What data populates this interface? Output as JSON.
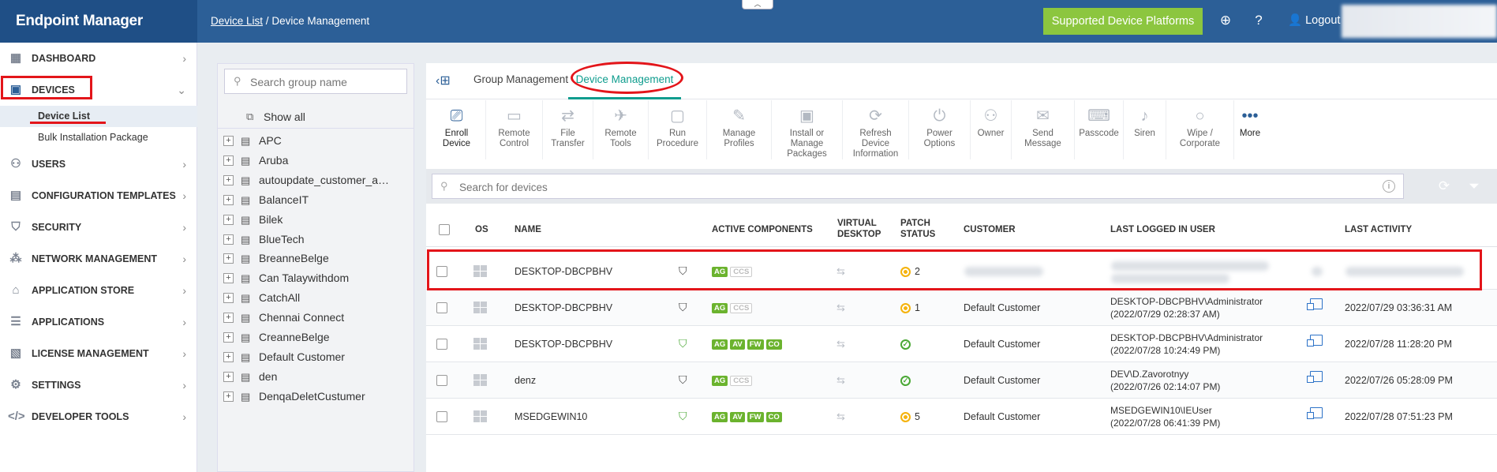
{
  "app": {
    "title": "Endpoint Manager"
  },
  "breadcrumb": {
    "link": "Device List",
    "separator": "/",
    "current": "Device Management"
  },
  "header": {
    "supported_btn": "Supported Device Platforms",
    "logout": "Logout",
    "icons": [
      "add-circle-icon",
      "help-icon",
      "user-icon"
    ]
  },
  "sidebar": {
    "items": [
      {
        "label": "DASHBOARD",
        "icon": "dashboard-icon"
      },
      {
        "label": "DEVICES",
        "icon": "devices-icon"
      },
      {
        "label": "USERS",
        "icon": "user-icon"
      },
      {
        "label": "CONFIGURATION TEMPLATES",
        "icon": "templates-icon"
      },
      {
        "label": "SECURITY",
        "icon": "shield-icon"
      },
      {
        "label": "NETWORK MANAGEMENT",
        "icon": "network-icon"
      },
      {
        "label": "APPLICATION STORE",
        "icon": "store-icon"
      },
      {
        "label": "APPLICATIONS",
        "icon": "applications-icon"
      },
      {
        "label": "LICENSE MANAGEMENT",
        "icon": "license-icon"
      },
      {
        "label": "SETTINGS",
        "icon": "gear-icon"
      },
      {
        "label": "DEVELOPER TOOLS",
        "icon": "code-icon"
      }
    ],
    "sub_items": [
      "Device List",
      "Bulk Installation Package"
    ]
  },
  "groups": {
    "search_placeholder": "Search group name",
    "show_all": "Show all",
    "items": [
      "APC",
      "Aruba",
      "autoupdate_customer_a…",
      "BalanceIT",
      "Bilek",
      "BlueTech",
      "BreanneBelge",
      "Can Talaywithdom",
      "CatchAll",
      "Chennai Connect",
      "CreanneBelge",
      "Default Customer",
      "den",
      "DenqaDeletCustumer"
    ]
  },
  "tabs": [
    "Group Management",
    "Device Management"
  ],
  "toolbar": [
    {
      "label": "Enroll Device",
      "icon": "enroll-device-icon",
      "enabled": true
    },
    {
      "label": "Remote Control",
      "icon": "remote-control-icon",
      "enabled": false
    },
    {
      "label": "File Transfer",
      "icon": "file-transfer-icon",
      "enabled": false
    },
    {
      "label": "Remote Tools",
      "icon": "remote-tools-icon",
      "enabled": false
    },
    {
      "label": "Run Procedure",
      "icon": "run-procedure-icon",
      "enabled": false
    },
    {
      "label": "Manage Profiles",
      "icon": "manage-profiles-icon",
      "enabled": false
    },
    {
      "label": "Install or Manage Packages",
      "icon": "packages-icon",
      "enabled": false
    },
    {
      "label": "Refresh Device Information",
      "icon": "refresh-icon",
      "enabled": false
    },
    {
      "label": "Power Options",
      "icon": "power-icon",
      "enabled": false
    },
    {
      "label": "Owner",
      "icon": "owner-icon",
      "enabled": false
    },
    {
      "label": "Send Message",
      "icon": "envelope-icon",
      "enabled": false
    },
    {
      "label": "Passcode",
      "icon": "passcode-icon",
      "enabled": false
    },
    {
      "label": "Siren",
      "icon": "siren-icon",
      "enabled": false
    },
    {
      "label": "Wipe / Corporate",
      "icon": "wipe-icon",
      "enabled": false
    },
    {
      "label": "More",
      "icon": "more-icon",
      "enabled": true
    }
  ],
  "device_search": {
    "placeholder": "Search for devices"
  },
  "table": {
    "headers": {
      "os": "OS",
      "name": "NAME",
      "active_components": "ACTIVE COMPONENTS",
      "virtual_desktop_1": "VIRTUAL",
      "virtual_desktop_2": "DESKTOP",
      "patch_status_1": "PATCH",
      "patch_status_2": "STATUS",
      "customer": "CUSTOMER",
      "last_logged_user": "LAST LOGGED IN USER",
      "last_activity": "LAST ACTIVITY"
    },
    "rows": [
      {
        "name": "DESKTOP-DBCPBHV",
        "components": [
          "AG"
        ],
        "off": [
          "CCS"
        ],
        "patch": "warn",
        "patch_count": "2",
        "customer": "",
        "user": "",
        "user_time": "",
        "activity": "",
        "redacted": true
      },
      {
        "name": "DESKTOP-DBCPBHV",
        "components": [
          "AG"
        ],
        "off": [
          "CCS"
        ],
        "patch": "warn",
        "patch_count": "1",
        "customer": "Default Customer",
        "user": "DESKTOP-DBCPBHV\\Administrator",
        "user_time": "(2022/07/29 02:28:37 AM)",
        "activity": "2022/07/29 03:36:31 AM"
      },
      {
        "name": "DESKTOP-DBCPBHV",
        "components": [
          "AG",
          "AV",
          "FW",
          "CO"
        ],
        "off": [],
        "patch": "ok",
        "patch_count": "",
        "customer": "Default Customer",
        "user": "DESKTOP-DBCPBHV\\Administrator",
        "user_time": "(2022/07/28 10:24:49 PM)",
        "activity": "2022/07/28 11:28:20 PM"
      },
      {
        "name": "denz",
        "components": [
          "AG"
        ],
        "off": [
          "CCS"
        ],
        "patch": "ok",
        "patch_count": "",
        "customer": "Default Customer",
        "user": "DEV\\D.Zavorotnyy",
        "user_time": "(2022/07/26 02:14:07 PM)",
        "activity": "2022/07/26 05:28:09 PM"
      },
      {
        "name": "MSEDGEWIN10",
        "components": [
          "AG",
          "AV",
          "FW",
          "CO"
        ],
        "off": [],
        "patch": "warn",
        "patch_count": "5",
        "customer": "Default Customer",
        "user": "MSEDGEWIN10\\IEUser",
        "user_time": "(2022/07/28 06:41:39 PM)",
        "activity": "2022/07/28 07:51:23 PM"
      }
    ]
  },
  "colors": {
    "topbar": "#2c5f97",
    "brand": "#1f4f86",
    "accent_green": "#8cc63f",
    "tab_active": "#0f9d8e",
    "annotation_red": "#e3151a"
  }
}
